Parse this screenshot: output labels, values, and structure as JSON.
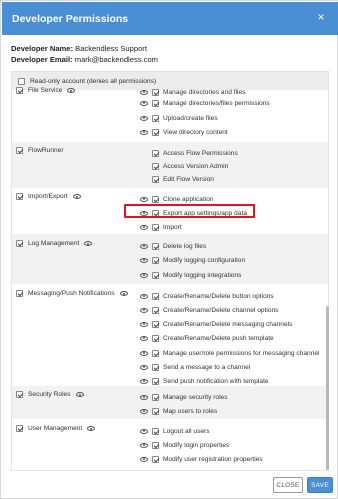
{
  "dialog": {
    "title": "Developer Permissions",
    "close_icon": "×"
  },
  "developer": {
    "name_label": "Developer Name:",
    "name_value": "Backendless Support",
    "email_label": "Developer Email:",
    "email_value": "mark@backendless.com"
  },
  "readonly": {
    "label": "Read-only account (denies all permissions)"
  },
  "sections": [
    {
      "name": "File Service",
      "perms": [
        "Manage directories and files",
        "Manage directories/files permissions",
        "Upload/create files",
        "View directory content"
      ]
    },
    {
      "name": "FlowRunner",
      "perms": [
        "Access Flow Permissions",
        "Access Version Admin",
        "Edit Flow Version"
      ]
    },
    {
      "name": "Import/Export",
      "perms": [
        "Clone application",
        "Export app settings/app data",
        "Import"
      ]
    },
    {
      "name": "Log Management",
      "perms": [
        "Delete log files",
        "Modify logging configuration",
        "Modify logging integrations"
      ]
    },
    {
      "name": "Messaging/Push Notifications",
      "perms": [
        "Create/Rename/Delete button options",
        "Create/Rename/Delete channel options",
        "Create/Rename/Delete messaging channels",
        "Create/Rename/Delete push template",
        "Manage user/role permissions for messaging channel",
        "Send a message to a channel",
        "Send push notification with template"
      ]
    },
    {
      "name": "Security Roles",
      "perms": [
        "Manage security roles",
        "Map users to roles"
      ]
    },
    {
      "name": "User Management",
      "perms": [
        "Logout all users",
        "Modify login properties",
        "Modify user registration properties"
      ]
    }
  ],
  "footer": {
    "close_label": "CLOSE",
    "save_label": "SAVE"
  },
  "colors": {
    "header": "#4a8fd3",
    "highlight": "#e0161c"
  }
}
